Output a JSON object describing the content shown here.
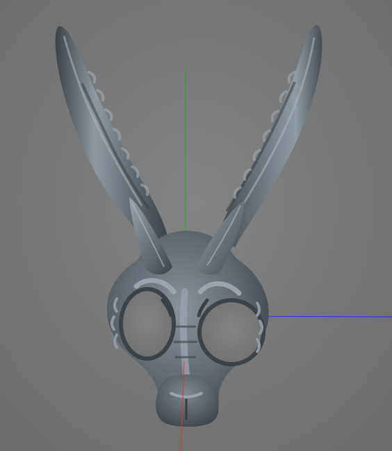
{
  "viewport": {
    "background": "#7b7b7b",
    "axis_colors": {
      "x": "#2a2aff",
      "y": "#16b316",
      "z": "#d03a3a"
    },
    "model": {
      "name": "rabbit-skull-mask",
      "base_color": "#616b74",
      "shadow_color": "#2c3136",
      "highlight_color": "#9aa3ab"
    }
  }
}
